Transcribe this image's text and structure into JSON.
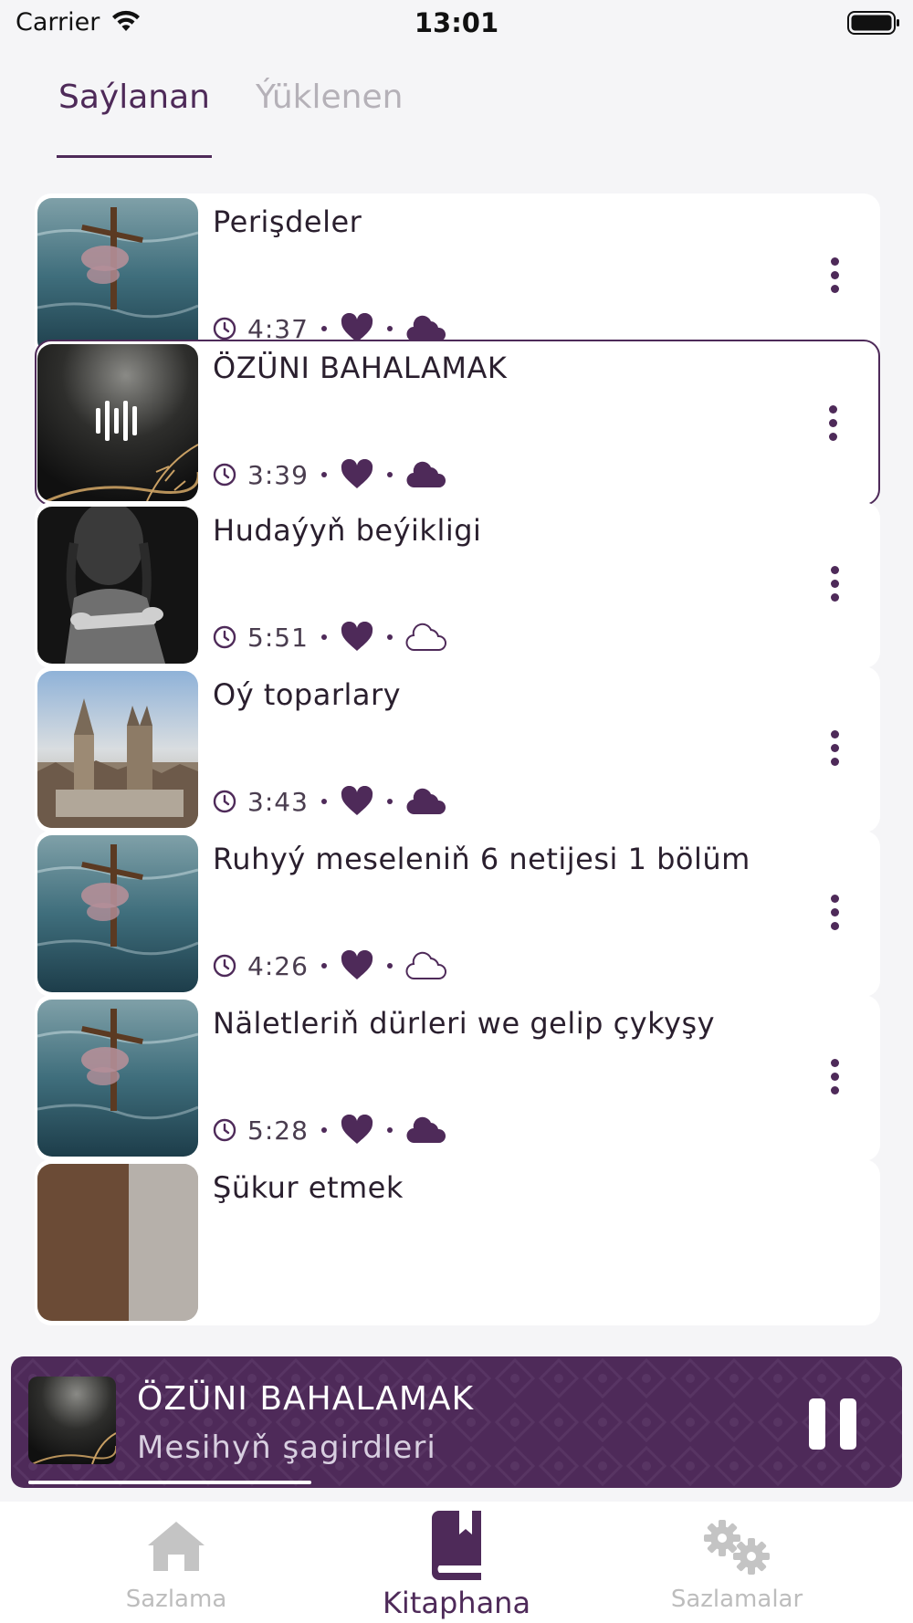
{
  "status_bar": {
    "carrier": "Carrier",
    "time": "13:01"
  },
  "tabs": {
    "selected": "Saýlanan",
    "downloaded": "Ýüklenen"
  },
  "tracks": [
    {
      "title": "Perişdeler",
      "duration": "4:37",
      "favorited": true,
      "cloud": "filled",
      "art": "cross"
    },
    {
      "title": "ÖZÜNI BAHALAMAK",
      "duration": "3:39",
      "favorited": true,
      "cloud": "filled",
      "art": "wheat",
      "playing": true
    },
    {
      "title": "Hudaýyň beýikligi",
      "duration": "5:51",
      "favorited": true,
      "cloud": "outline",
      "art": "reader"
    },
    {
      "title": "Oý toparlary",
      "duration": "3:43",
      "favorited": true,
      "cloud": "filled",
      "art": "church"
    },
    {
      "title": "Ruhyý meseleniň 6 netijesi 1 bölüm",
      "duration": "4:26",
      "favorited": true,
      "cloud": "outline",
      "art": "cross"
    },
    {
      "title": "Näletleriň dürleri we gelip çykyşy",
      "duration": "5:28",
      "favorited": true,
      "cloud": "filled",
      "art": "cross"
    },
    {
      "title": "Şükur etmek",
      "duration": "",
      "favorited": false,
      "cloud": "",
      "art": "portrait"
    }
  ],
  "player": {
    "title": "ÖZÜNI BAHALAMAK",
    "subtitle": "Mesihyň şagirdleri",
    "progress": 0.33
  },
  "nav": {
    "home": "Sazlama",
    "library": "Kitaphana",
    "settings": "Sazlamalar"
  },
  "colors": {
    "accent": "#4e2a59",
    "background": "#f5f5f7",
    "inactive": "#bdbdbd"
  },
  "icons": [
    "wifi-icon",
    "battery-icon",
    "clock-icon",
    "heart-icon",
    "cloud-icon",
    "more-icon",
    "pause-icon",
    "home-icon",
    "book-icon",
    "gears-icon",
    "equalizer-icon"
  ]
}
